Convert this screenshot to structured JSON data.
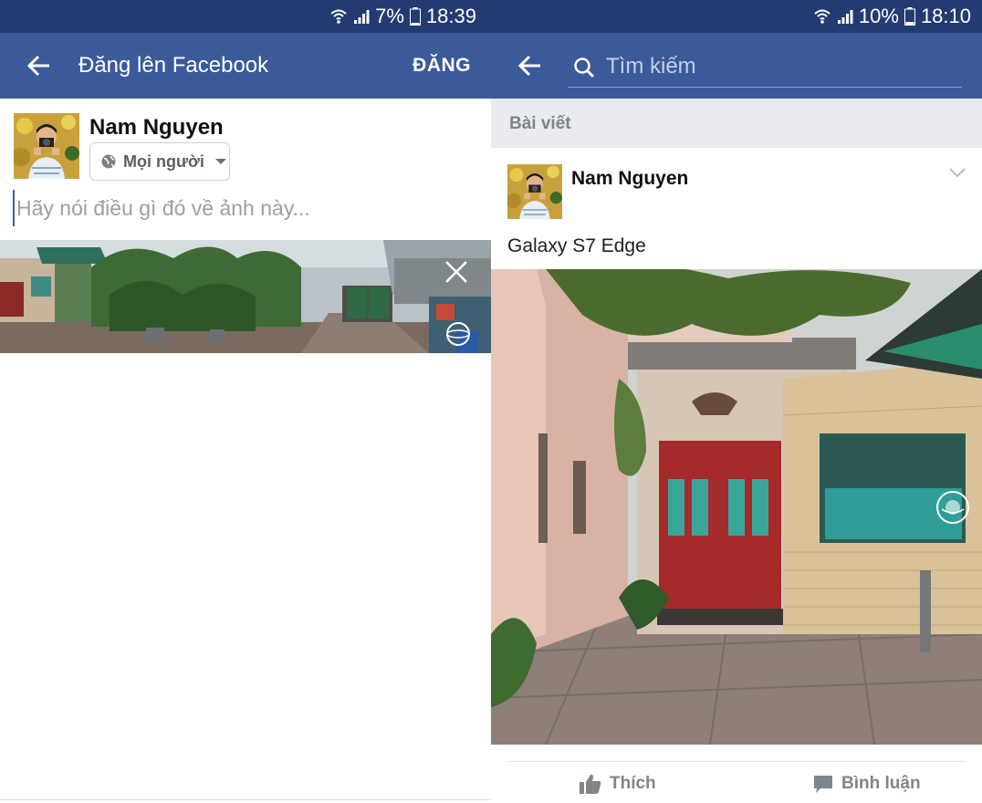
{
  "left": {
    "status": {
      "battery": "7%",
      "time": "18:39"
    },
    "appbar": {
      "title": "Đăng lên Facebook",
      "post_label": "ĐĂNG"
    },
    "composer": {
      "user_name": "Nam Nguyen",
      "audience": "Mọi người",
      "placeholder": "Hãy nói điều gì đó về ảnh này..."
    }
  },
  "right": {
    "status": {
      "battery": "10%",
      "time": "18:10"
    },
    "search": {
      "placeholder": "Tìm kiếm"
    },
    "section_title": "Bài viết",
    "post": {
      "author": "Nam Nguyen",
      "text": "Galaxy S7 Edge"
    },
    "actions": {
      "like": "Thích",
      "comment": "Bình luận"
    }
  },
  "colors": {
    "statusbar": "#233b71",
    "appbar": "#3b5a9a",
    "section_bg": "#e9ebee",
    "muted_text": "#7f858d"
  },
  "icons": [
    "wifi-icon",
    "signal-icon",
    "battery-icon",
    "back-arrow-icon",
    "globe-icon",
    "close-icon",
    "panorama-360-icon",
    "search-icon",
    "chevron-down-icon",
    "like-icon",
    "comment-icon"
  ]
}
